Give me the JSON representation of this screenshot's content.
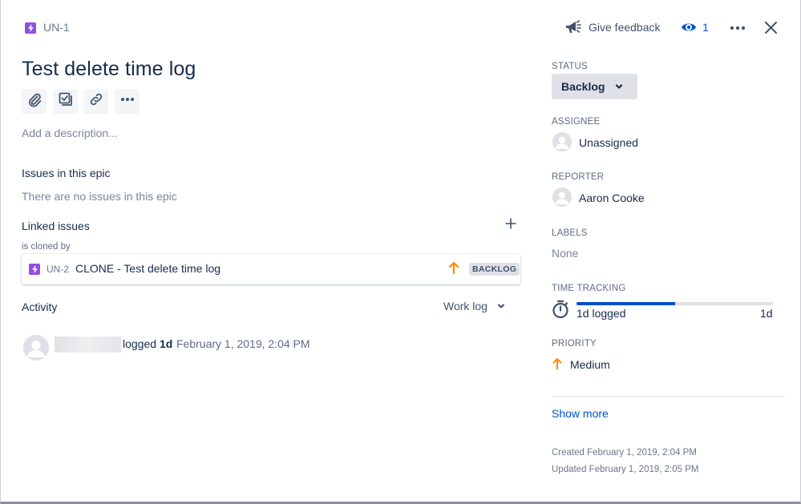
{
  "header": {
    "issue_key": "UN-1",
    "give_feedback_label": "Give feedback",
    "watch_count": "1"
  },
  "issue": {
    "title": "Test delete time log",
    "description_placeholder": "Add a description..."
  },
  "toolbar": {
    "icons": [
      "attachment-icon",
      "subtask-checklist-icon",
      "link-icon",
      "more-icon"
    ]
  },
  "epic_issues": {
    "heading": "Issues in this epic",
    "empty_text": "There are no issues in this epic"
  },
  "linked_issues": {
    "heading": "Linked issues",
    "relation_label": "is cloned by",
    "items": [
      {
        "key": "UN-2",
        "summary": "CLONE - Test delete time log",
        "status": "BACKLOG",
        "priority_icon": "priority-medium-icon"
      }
    ]
  },
  "activity": {
    "heading": "Activity",
    "filter_label": "Work log",
    "entries": [
      {
        "action_text": "logged",
        "amount": "1d",
        "date": "February 1, 2019, 2:04 PM"
      }
    ]
  },
  "sidebar": {
    "status": {
      "label": "STATUS",
      "value": "Backlog"
    },
    "assignee": {
      "label": "ASSIGNEE",
      "value": "Unassigned"
    },
    "reporter": {
      "label": "REPORTER",
      "value": "Aaron Cooke"
    },
    "labels": {
      "label": "LABELS",
      "value": "None"
    },
    "time_tracking": {
      "label": "TIME TRACKING",
      "logged": "1d logged",
      "remaining": "1d",
      "progress_fraction": 0.5
    },
    "priority": {
      "label": "PRIORITY",
      "value": "Medium"
    },
    "show_more_label": "Show more",
    "created": "Created February 1, 2019, 2:04 PM",
    "updated": "Updated February 1, 2019, 2:05 PM"
  },
  "colors": {
    "epic": "#904EE2",
    "link": "#0052CC",
    "priority_medium": "#FF8B00",
    "status_bg": "#DFE1E6"
  }
}
